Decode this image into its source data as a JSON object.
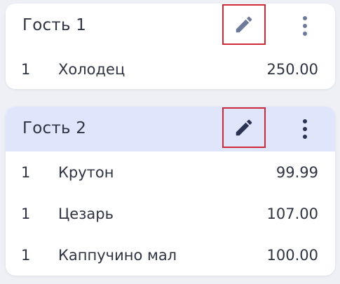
{
  "guests": [
    {
      "name": "Гость 1",
      "selected": false,
      "icon_color": "#6d7a9a",
      "items": [
        {
          "qty": "1",
          "name": "Холодец",
          "price": "250.00"
        }
      ]
    },
    {
      "name": "Гость 2",
      "selected": true,
      "icon_color": "#2b3352",
      "items": [
        {
          "qty": "1",
          "name": "Крутон",
          "price": "99.99"
        },
        {
          "qty": "1",
          "name": "Цезарь",
          "price": "107.00"
        },
        {
          "qty": "1",
          "name": "Каппучино мал",
          "price": "100.00"
        }
      ]
    }
  ],
  "icons": {
    "edit": "pencil-icon",
    "more": "more-vertical-icon"
  },
  "colors": {
    "selected_header_bg": "#dfe5fb",
    "highlight_border": "#cf2a36"
  }
}
